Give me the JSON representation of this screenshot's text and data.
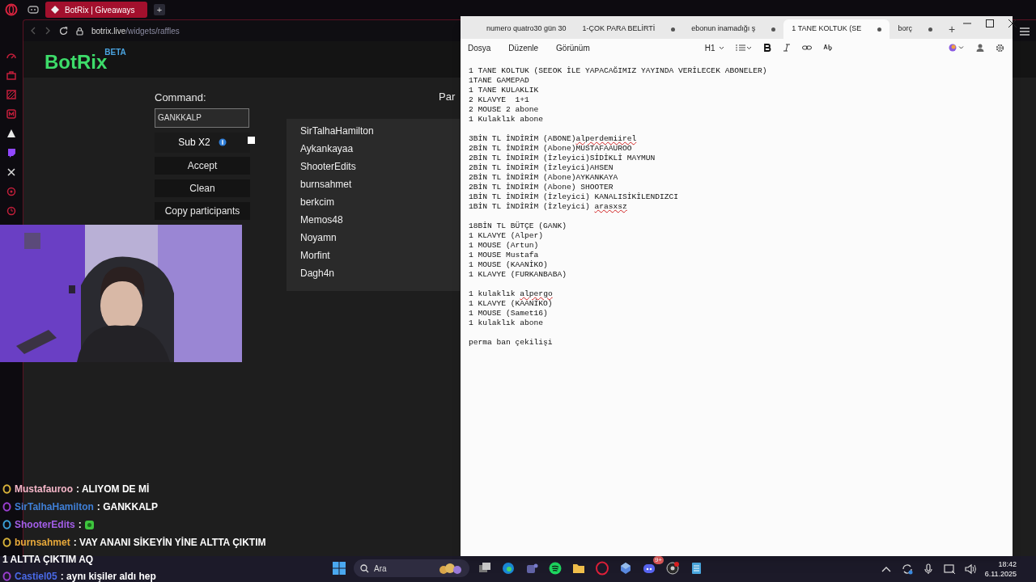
{
  "browser": {
    "tab": {
      "title": "BotRix | Giveaways",
      "selected": true
    },
    "new_tab": "+",
    "url": {
      "host": "botrix.live",
      "path": "/widgets/raffles"
    }
  },
  "botrix": {
    "logo": "BotRix",
    "logo_badge": "BETA",
    "command": {
      "label": "Command:",
      "value": "GANKKALP"
    },
    "sub_x2": {
      "label": "Sub X2",
      "checked": false
    },
    "buttons": [
      "Accept",
      "Clean",
      "Copy participants"
    ],
    "participants_heading": "Par",
    "participants": [
      "SirTalhaHamilton",
      "Aykankayaa",
      "ShooterEdits",
      "burnsahmet",
      "berkcim",
      "Memos48",
      "Noyamn",
      "Morfint",
      "Dagh4n"
    ]
  },
  "chat": [
    {
      "user": "Mustafauroo",
      "color": "#f4b6c8",
      "badge": {
        "color": "#d8b23a"
      },
      "message": ": ALIYOM DE Mİ"
    },
    {
      "user": "SirTalhaHamilton",
      "color": "#3f7fd6",
      "badge": {
        "color": "#9a3ed0"
      },
      "message": ": GANKKALP"
    },
    {
      "user": "ShooterEdits",
      "color": "#a35ee8",
      "badge": {
        "color": "#3aa0d8"
      },
      "message": ":",
      "emote": true
    },
    {
      "user": "burnsahmet",
      "color": "#e8a93a",
      "badge": {
        "color": "#d8b23a"
      },
      "message": ": VAY ANANI SİKEYİN YİNE ALTTA ÇIKTIM",
      "continuation": "1 ALTTA ÇIKTIM AQ"
    },
    {
      "user": "Castiel05",
      "color": "#4a6ae8",
      "badge": {
        "color": "#9a3ed0"
      },
      "message": ": aynı kişiler aldı hep"
    }
  ],
  "notepad": {
    "tabs": [
      {
        "title": "numero quatro30 gün 30",
        "selected": false,
        "unsaved": false
      },
      {
        "title": "1-ÇOK PARA BELİRTİ",
        "selected": false,
        "unsaved": true
      },
      {
        "title": "ebonun inamadığı ş",
        "selected": false,
        "unsaved": true
      },
      {
        "title": "1 TANE KOLTUK (SE",
        "selected": true,
        "unsaved": true
      },
      {
        "title": "borç",
        "selected": false,
        "unsaved": true
      }
    ],
    "new_tab": "+",
    "menu": [
      "Dosya",
      "Düzenle",
      "Görünüm"
    ],
    "heading_select": "H1",
    "paragraphs": [
      [
        {
          "text": "1 TANE KOLTUK (SEEOK İLE YAPACAĞIMIZ YAYINDA VERİLECEK ABONELER)"
        },
        {
          "text": "1TANE GAMEPAD"
        },
        {
          "text": "1 TANE KULAKLIK"
        },
        {
          "text": "2 KLAVYE  1+1"
        },
        {
          "text": "2 MOUSE 2 abone"
        },
        {
          "text": "1 Kulaklık abone"
        }
      ],
      [
        {
          "text": "3BİN TL İNDİRİM (ABONE)",
          "misspelled": "alperdemiirel"
        },
        {
          "text": "2BİN TL İNDİRİM (Abone)MUSTAFAAUROO"
        },
        {
          "text": "2BİN TL İNDİRİM (İzleyici)SİDİKLİ MAYMUN"
        },
        {
          "text": "2BİN TL İNDİRİM (İzleyici)AHSEN"
        },
        {
          "text": "2BİN TL İNDİRİM (Abone)AYKANKAYA"
        },
        {
          "text": "2BİN TL İNDİRİM (Abone) SHOOTER"
        },
        {
          "text": "1BİN TL İNDİRİM (İzleyici) KANALISİKİLENDIZCI"
        },
        {
          "text": "1BİN TL İNDİRİM (İzleyici) ",
          "misspelled": "arasxsz"
        }
      ],
      [
        {
          "text": "18BİN TL BÜTÇE (GANK)"
        },
        {
          "text": "1 KLAVYE (Alper)"
        },
        {
          "text": "1 MOUSE (Artun)"
        },
        {
          "text": "1 MOUSE Mustafa"
        },
        {
          "text": "1 MOUSE (KAANİKO)"
        },
        {
          "text": "1 KLAVYE (FURKANBABA)"
        }
      ],
      [
        {
          "text": "1 kulaklık ",
          "misspelled": "alpergo"
        },
        {
          "text": "1 KLAVYE (KAANİKO)"
        },
        {
          "text": "1 MOUSE (Samet16)"
        },
        {
          "text": "1 kulaklık abone"
        }
      ],
      [
        {
          "text": "perma ban çekilişi"
        }
      ]
    ]
  },
  "taskbar": {
    "search_placeholder": "Ara",
    "discord_badge": "9+",
    "time": "18:42",
    "date": "6.11.2025"
  }
}
